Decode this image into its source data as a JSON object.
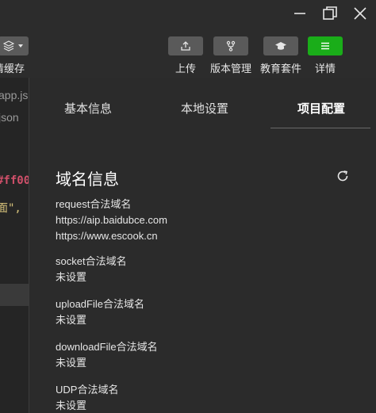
{
  "toolbar": {
    "cache_label": "清缓存",
    "upload_label": "上传",
    "version_label": "版本管理",
    "edu_label": "教育套件",
    "detail_label": "详情"
  },
  "left_strip": {
    "tab1": "app.js",
    "tab2": "json",
    "code1": "#ff00",
    "code2": "面\","
  },
  "tabs": {
    "basic": "基本信息",
    "local": "本地设置",
    "project": "项目配置"
  },
  "domain_info": {
    "title": "域名信息",
    "groups": [
      {
        "label": "request合法域名",
        "values": [
          "https://aip.baidubce.com",
          "https://www.escook.cn"
        ]
      },
      {
        "label": "socket合法域名",
        "values": [
          "未设置"
        ]
      },
      {
        "label": "uploadFile合法域名",
        "values": [
          "未设置"
        ]
      },
      {
        "label": "downloadFile合法域名",
        "values": [
          "未设置"
        ]
      },
      {
        "label": "UDP合法域名",
        "values": [
          "未设置"
        ]
      }
    ]
  },
  "colors": {
    "accent_green": "#1aad19",
    "background": "#2c2c2c"
  }
}
